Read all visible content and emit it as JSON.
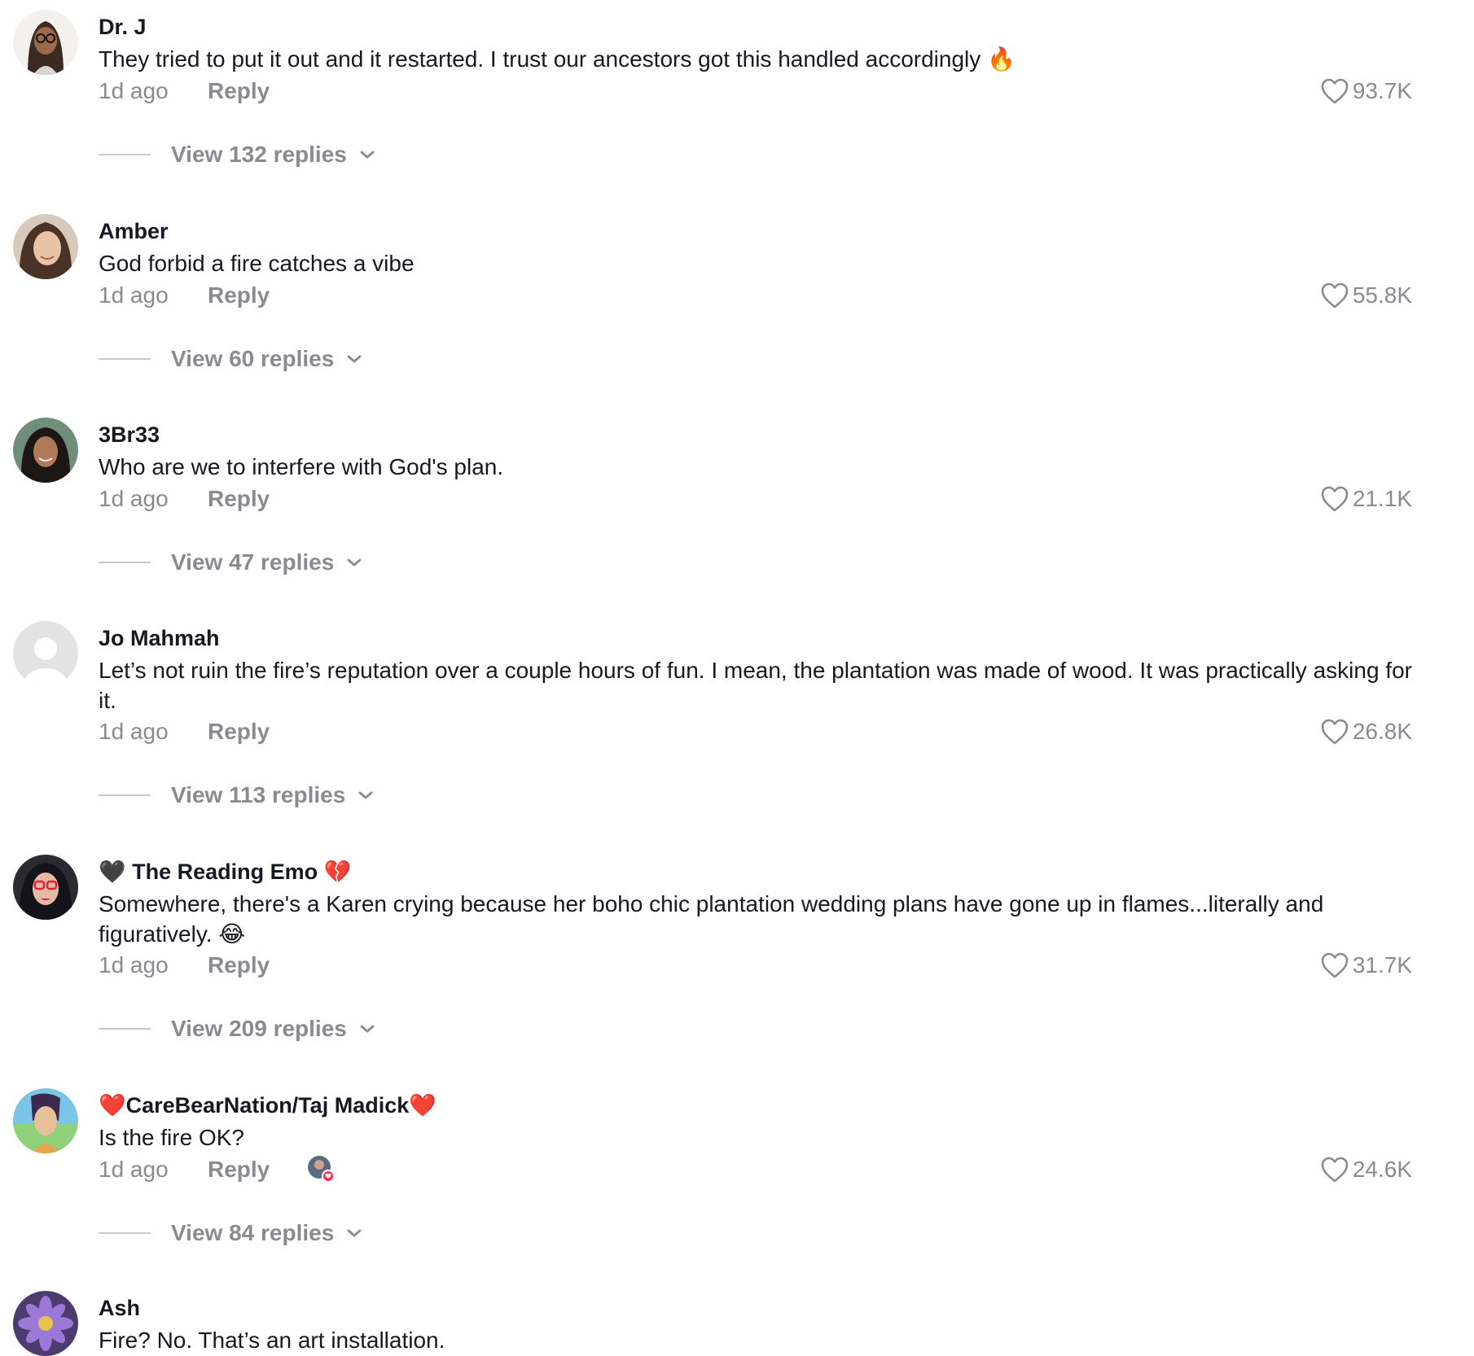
{
  "comments": [
    {
      "username": "Dr. J",
      "text": "They tried to put it out and it restarted. I trust our ancestors got this handled accordingly 🔥",
      "time": "1d ago",
      "reply_label": "Reply",
      "likes": "93.7K",
      "view_replies": "View 132 replies",
      "avatar": "cartoon-woman-glasses-avatar"
    },
    {
      "username": "Amber",
      "text": "God forbid a fire catches a vibe",
      "time": "1d ago",
      "reply_label": "Reply",
      "likes": "55.8K",
      "view_replies": "View 60 replies",
      "avatar": "woman-photo-avatar"
    },
    {
      "username": "3Br33",
      "text": "Who are we to interfere with God's plan.",
      "time": "1d ago",
      "reply_label": "Reply",
      "likes": "21.1K",
      "view_replies": "View 47 replies",
      "avatar": "woman-outdoor-avatar"
    },
    {
      "username": "Jo Mahmah",
      "text": "Let’s not ruin the fire’s reputation over a couple hours of fun. I mean, the plantation was made of wood. It was practically asking for it.",
      "time": "1d ago",
      "reply_label": "Reply",
      "likes": "26.8K",
      "view_replies": "View 113 replies",
      "avatar": "default-user-avatar"
    },
    {
      "username": "🖤 The Reading Emo 💔",
      "text": "Somewhere, there's a Karen crying because her boho chic plantation wedding plans have gone up in flames...literally and figuratively. 😂",
      "time": "1d ago",
      "reply_label": "Reply",
      "likes": "31.7K",
      "view_replies": "View 209 replies",
      "avatar": "woman-red-glasses-avatar"
    },
    {
      "username": "❤️CareBearNation/Taj Madick❤️",
      "text": "Is the fire OK?",
      "time": "1d ago",
      "reply_label": "Reply",
      "likes": "24.6K",
      "view_replies": "View 84 replies",
      "avatar": "cartoon-character-avatar",
      "creator_liked": true
    },
    {
      "username": "Ash",
      "text": "Fire? No. That’s an art installation.",
      "avatar": "purple-flower-avatar"
    }
  ],
  "colors": {
    "text": "#161823",
    "muted": "#8a8b91",
    "divider": "#c9c9cc",
    "liked_badge": "#fe2c55"
  },
  "icons": {
    "like": "heart-outline-icon",
    "expand": "chevron-down-icon"
  }
}
